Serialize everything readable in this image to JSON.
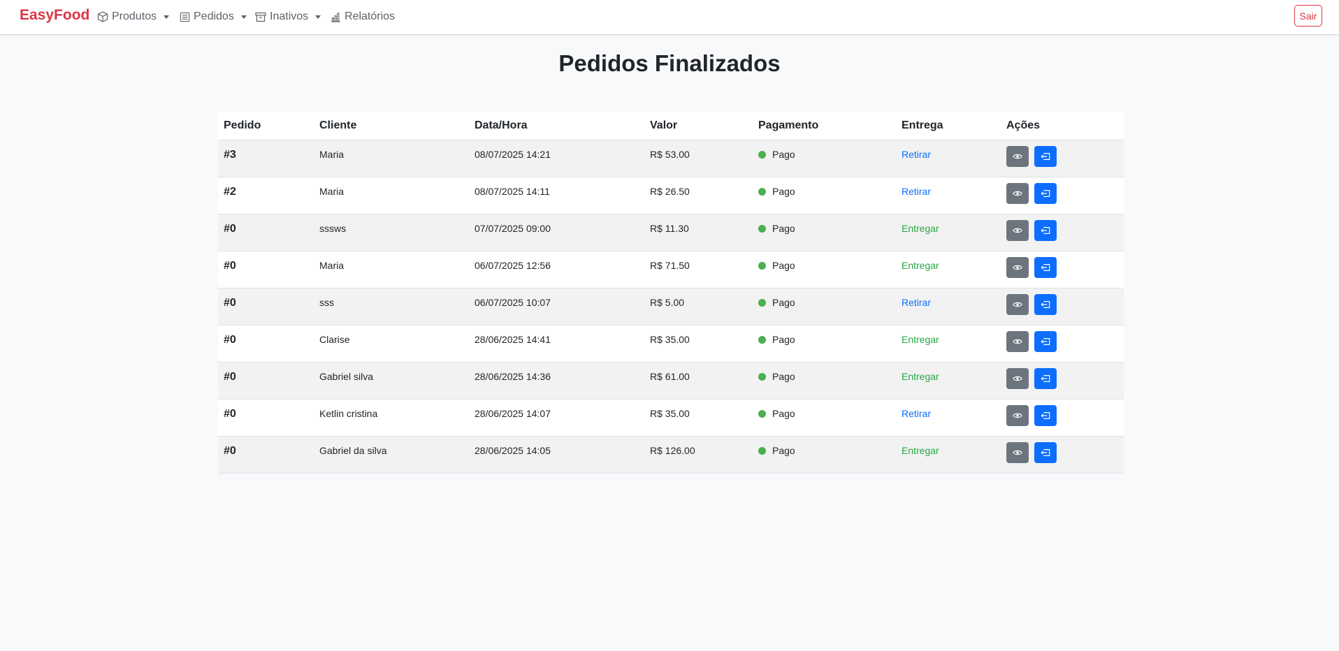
{
  "navbar": {
    "brand": "EasyFood",
    "menu": [
      {
        "label": "Produtos",
        "icon": "box-icon",
        "dropdown": true
      },
      {
        "label": "Pedidos",
        "icon": "list-icon",
        "dropdown": true
      },
      {
        "label": "Inativos",
        "icon": "archive-icon",
        "dropdown": true
      },
      {
        "label": "Relatórios",
        "icon": "bar-chart-icon",
        "dropdown": false
      }
    ],
    "logout_label": "Sair"
  },
  "page": {
    "title": "Pedidos Finalizados"
  },
  "table": {
    "headers": [
      "Pedido",
      "Cliente",
      "Data/Hora",
      "Valor",
      "Pagamento",
      "Entrega",
      "Ações"
    ],
    "rows": [
      {
        "pedido": "#3",
        "cliente": "Maria",
        "data_hora": "08/07/2025 14:21",
        "valor": "R$ 53.00",
        "pagamento": "Pago",
        "entrega": "Retirar"
      },
      {
        "pedido": "#2",
        "cliente": "Maria",
        "data_hora": "08/07/2025 14:11",
        "valor": "R$ 26.50",
        "pagamento": "Pago",
        "entrega": "Retirar"
      },
      {
        "pedido": "#0",
        "cliente": "sssws",
        "data_hora": "07/07/2025 09:00",
        "valor": "R$ 11.30",
        "pagamento": "Pago",
        "entrega": "Entregar"
      },
      {
        "pedido": "#0",
        "cliente": "Maria",
        "data_hora": "06/07/2025 12:56",
        "valor": "R$ 71.50",
        "pagamento": "Pago",
        "entrega": "Entregar"
      },
      {
        "pedido": "#0",
        "cliente": "sss",
        "data_hora": "06/07/2025 10:07",
        "valor": "R$ 5.00",
        "pagamento": "Pago",
        "entrega": "Retirar"
      },
      {
        "pedido": "#0",
        "cliente": "Clarise",
        "data_hora": "28/06/2025 14:41",
        "valor": "R$ 35.00",
        "pagamento": "Pago",
        "entrega": "Entregar"
      },
      {
        "pedido": "#0",
        "cliente": "Gabriel silva",
        "data_hora": "28/06/2025 14:36",
        "valor": "R$ 61.00",
        "pagamento": "Pago",
        "entrega": "Entregar"
      },
      {
        "pedido": "#0",
        "cliente": "Ketlin cristina",
        "data_hora": "28/06/2025 14:07",
        "valor": "R$ 35.00",
        "pagamento": "Pago",
        "entrega": "Retirar"
      },
      {
        "pedido": "#0",
        "cliente": "Gabriel da silva",
        "data_hora": "28/06/2025 14:05",
        "valor": "R$ 126.00",
        "pagamento": "Pago",
        "entrega": "Entregar"
      }
    ]
  },
  "colors": {
    "brand": "#dc3545",
    "paid_dot": "#4caf50",
    "retirar": "#0d6efd",
    "entregar": "#28a745",
    "view_button": "#6c757d",
    "send_button": "#0d6efd"
  }
}
